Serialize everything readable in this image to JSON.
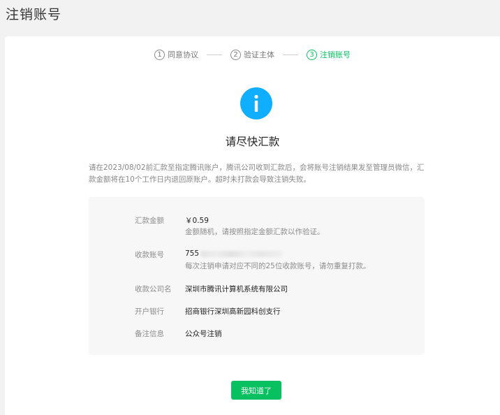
{
  "page": {
    "title": "注销账号"
  },
  "steps": [
    {
      "num": "1",
      "label": "同意协议",
      "active": false
    },
    {
      "num": "2",
      "label": "验证主体",
      "active": false
    },
    {
      "num": "3",
      "label": "注销账号",
      "active": true
    }
  ],
  "notice": {
    "icon": "info-icon",
    "headline": "请尽快汇款",
    "description": "请在2023/08/02前汇款至指定腾讯账户，腾讯公司收到汇款后，会将账号注销结果发至管理员微信，汇款金额将在10个工作日内退回原账户。超时未打款会导致注销失败。"
  },
  "details": {
    "amount": {
      "label": "汇款金额",
      "value": "￥0.59",
      "note": "金额随机，请按照指定金额汇款以作验证。"
    },
    "account": {
      "label": "收款账号",
      "value": "755",
      "note": "每次注销申请对应不同的25位收款账号，请勿重复打款。"
    },
    "company": {
      "label": "收款公司名",
      "value": "深圳市腾讯计算机系统有限公司"
    },
    "bank": {
      "label": "开户银行",
      "value": "招商银行深圳高新园科创支行"
    },
    "remark": {
      "label": "备注信息",
      "value": "公众号注销"
    }
  },
  "actions": {
    "confirm_label": "我知道了"
  },
  "colors": {
    "accent": "#07c160",
    "info": "#10aeff"
  }
}
